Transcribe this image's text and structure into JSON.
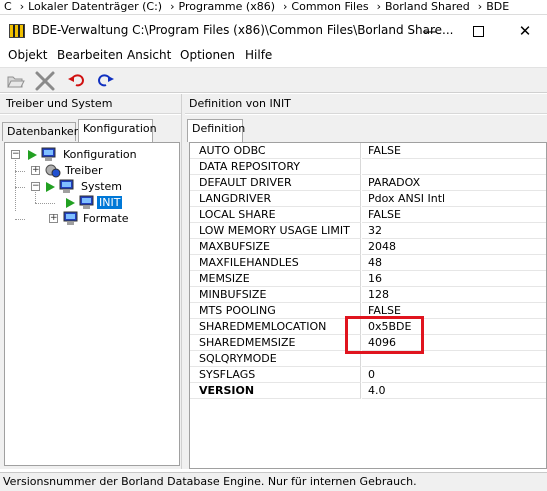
{
  "breadcrumb": [
    "C",
    "Lokaler Datenträger (C:)",
    "Programme (x86)",
    "Common Files",
    "Borland Shared",
    "BDE"
  ],
  "window": {
    "title": "BDE-Verwaltung  C:\\Program Files (x86)\\Common Files\\Borland Share...",
    "minimize": "—",
    "close": "✕"
  },
  "menu": [
    "Objekt",
    "Bearbeiten",
    "Ansicht",
    "Optionen",
    "Hilfe"
  ],
  "left_header": "Treiber und System",
  "right_header": "Definition von INIT",
  "left_tabs": [
    "Datenbanken",
    "Konfiguration"
  ],
  "right_tab": "Definition",
  "tree": {
    "root": "Konfiguration",
    "drivers": "Treiber",
    "system": "System",
    "init": "INIT",
    "formats": "Formate"
  },
  "properties": [
    {
      "key": "AUTO ODBC",
      "value": "FALSE"
    },
    {
      "key": "DATA REPOSITORY",
      "value": ""
    },
    {
      "key": "DEFAULT DRIVER",
      "value": "PARADOX"
    },
    {
      "key": "LANGDRIVER",
      "value": "Pdox ANSI Intl"
    },
    {
      "key": "LOCAL SHARE",
      "value": "FALSE"
    },
    {
      "key": "LOW MEMORY USAGE LIMIT",
      "value": "32"
    },
    {
      "key": "MAXBUFSIZE",
      "value": "2048"
    },
    {
      "key": "MAXFILEHANDLES",
      "value": "48"
    },
    {
      "key": "MEMSIZE",
      "value": "16"
    },
    {
      "key": "MINBUFSIZE",
      "value": "128"
    },
    {
      "key": "MTS POOLING",
      "value": "FALSE"
    },
    {
      "key": "SHAREDMEMLOCATION",
      "value": "0x5BDE"
    },
    {
      "key": "SHAREDMEMSIZE",
      "value": "4096"
    },
    {
      "key": "SQLQRYMODE",
      "value": ""
    },
    {
      "key": "SYSFLAGS",
      "value": "0"
    },
    {
      "key": "VERSION",
      "value": "4.0"
    }
  ],
  "status": "Versionsnummer der Borland Database Engine.  Nur für internen Gebrauch.",
  "colors": {
    "selection": "#0078d7",
    "highlight_box": "#e0141e"
  },
  "icons": {
    "toolbar": [
      "open-folder-icon",
      "delete-x-icon",
      "undo-icon",
      "redo-icon"
    ]
  }
}
